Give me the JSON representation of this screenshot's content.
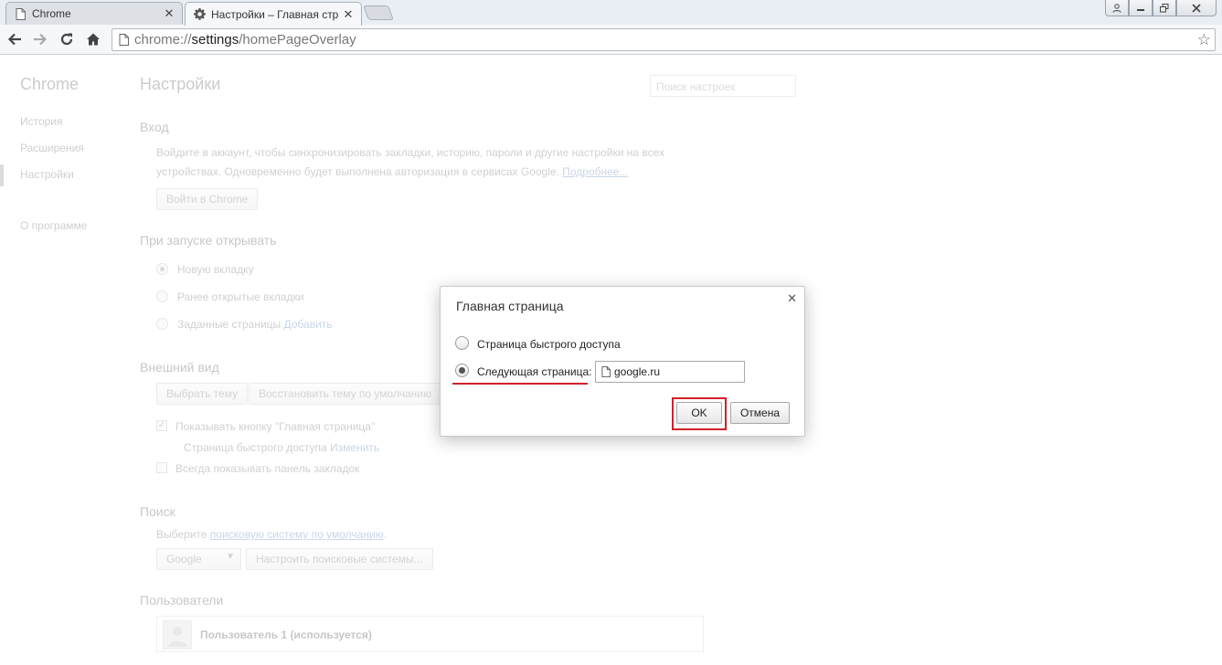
{
  "tabs": [
    {
      "title": "Chrome",
      "icon": "page-icon",
      "active": false
    },
    {
      "title": "Настройки – Главная стр",
      "icon": "gear-icon",
      "active": true
    }
  ],
  "toolbar": {
    "url_scheme": "chrome://",
    "url_host": "settings",
    "url_path": "/homePageOverlay"
  },
  "sidebar": {
    "title": "Chrome",
    "items": [
      "История",
      "Расширения",
      "Настройки",
      "О программе"
    ]
  },
  "settings": {
    "title": "Настройки",
    "search_placeholder": "Поиск настроек",
    "signin": {
      "title": "Вход",
      "text_line1": "Войдите в аккаунт, чтобы синхронизировать закладки, историю, пароли и другие настройки на всех",
      "text_line2": "устройствах. Одновременно будет выполнена авторизация в сервисах Google.",
      "more_link": "Подробнее...",
      "button": "Войти в Chrome"
    },
    "startup": {
      "title": "При запуске открывать",
      "options": [
        "Новую вкладку",
        "Ранее открытые вкладки",
        "Заданные страницы"
      ],
      "add_link": "Добавить"
    },
    "appearance": {
      "title": "Внешний вид",
      "choose_theme": "Выбрать тему",
      "reset_theme": "Восстановить тему по умолчанию",
      "show_home": "Показывать кнопку \"Главная страница\"",
      "home_value": "Страница быстрого доступа",
      "change_link": "Изменить",
      "show_bookmarks": "Всегда показывать панель закладок"
    },
    "search": {
      "title": "Поиск",
      "text_prefix": "Выберите",
      "text_link": "поисковую систему по умолчанию",
      "text_suffix": ".",
      "engine": "Google",
      "manage": "Настроить поисковые системы..."
    },
    "users": {
      "title": "Пользователи",
      "current_user": "Пользователь 1 (используется)"
    }
  },
  "dialog": {
    "title": "Главная страница",
    "option_ntp": "Страница быстрого доступа",
    "option_url": "Следующая страница:",
    "url_value": "google.ru",
    "ok": "OK",
    "cancel": "Отмена"
  },
  "colors": {
    "highlight": "#d0202a",
    "link": "#9cb3d6"
  }
}
